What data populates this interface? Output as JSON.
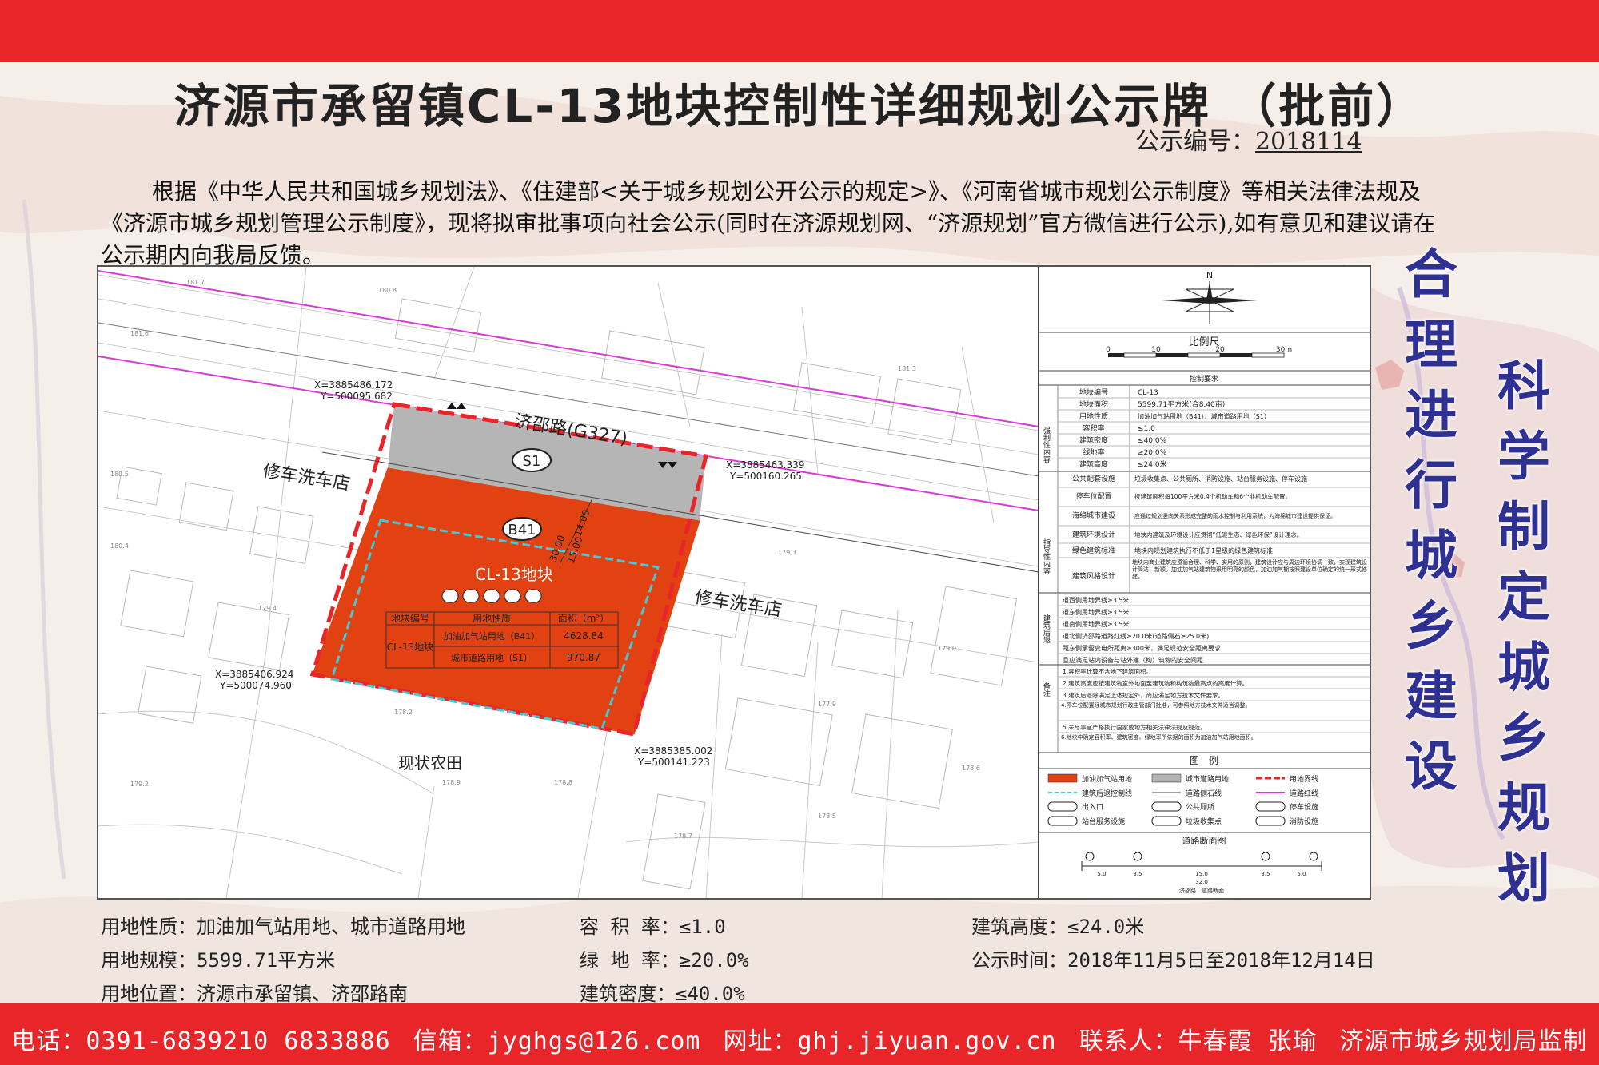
{
  "header": {
    "title": "济源市承留镇CL-13地块控制性详细规划公示牌 （批前）",
    "notice_label": "公示编号：",
    "notice_number": "2018114"
  },
  "intro": "根据《中华人民共和国城乡规划法》、《住建部<关于城乡规划公开公示的规定>》、《河南省城市规划公示制度》等相关法律法规及《济源市城乡规划管理公示制度》，现将拟审批事项向社会公示(同时在济源规划网、“济源规划”官方微信进行公示),如有意见和建议请在公示期内向我局反馈。",
  "map": {
    "road_name": "济邵路(G327)",
    "road_code": "S1",
    "block_code": "B41",
    "block_name": "CL-13地块",
    "shop_label": "修车洗车店",
    "farmland_label": "现状农田",
    "dim_14": "14.00",
    "dim_30": "30.00",
    "dim_15": "15.00",
    "coords": [
      "X=3885486.172",
      "Y=500095.682",
      "X=3885463.339",
      "Y=500160.265",
      "X=3885406.924",
      "Y=500074.960",
      "X=3885385.002",
      "Y=500141.223"
    ],
    "elevations": [
      "181.7",
      "181.6",
      "180.5",
      "180.4",
      "179.4",
      "179.2",
      "178.9",
      "178.8",
      "178.7",
      "178.5",
      "178.2",
      "177.9",
      "179.3",
      "179.0",
      "178.6",
      "180.8",
      "181.3"
    ],
    "mini_table": {
      "headers": [
        "地块编号",
        "用地性质",
        "面积（m²）"
      ],
      "block_id": "CL-13地块",
      "rows": [
        {
          "use": "加油加气站用地（B41）",
          "area": "4628.84"
        },
        {
          "use": "城市道路用地（S1）",
          "area": "970.87"
        }
      ]
    }
  },
  "side_panel": {
    "north": "N",
    "scale_title": "比例尺",
    "scale_ticks": [
      "0",
      "10",
      "20",
      "30m"
    ],
    "control_title": "控制要求",
    "control_rows": [
      {
        "k": "地块编号",
        "v": "CL-13"
      },
      {
        "k": "地块面积",
        "v": "5599.71平方米(合8.40亩)"
      },
      {
        "k": "用地性质",
        "v": "加油加气站用地（B41）、城市道路用地（S1）"
      },
      {
        "k": "容积率",
        "v": "≤1.0"
      },
      {
        "k": "建筑密度",
        "v": "≤40.0%"
      },
      {
        "k": "绿地率",
        "v": "≥20.0%"
      },
      {
        "k": "建筑高度",
        "v": "≤24.0米"
      }
    ],
    "group_mandatory": "强制性内容",
    "guide_rows": [
      {
        "k": "公共配套设施",
        "v": "垃圾收集点、公共厕所、消防设施、站台服务设施、停车设施"
      },
      {
        "k": "停车位配置",
        "v": "按建筑面积每100平方米0.4个机动车和6个非机动车配置。"
      },
      {
        "k": "海绵城市建设",
        "v": "应通过规划竖向关系形成完整的雨水控制与利用系统，为海绵城市建设提供保证。"
      },
      {
        "k": "建筑环境设计",
        "v": "地块内建筑及环境设计应贯彻“低碳生态、绿色环保”设计理念。"
      },
      {
        "k": "绿色建筑标准",
        "v": "地块内规划建筑执行不低于1星级的绿色建筑标准"
      },
      {
        "k": "建筑风格设计",
        "v": "地块内商业建筑应遵循合理、科学、实用的原则，建筑设计应与周边环境协调一致，实现建筑设计简洁、新颖。加油加气站建筑物采用明亮的颜色，加油加气棚按照建设单位确定的统一形式修建。"
      }
    ],
    "group_guide": "指导性内容",
    "setback_rows": [
      "退西侧用地界线≥3.5米",
      "退东侧用地界线≥3.5米",
      "退南侧用地界线≥3.5米",
      "退北侧济邵路道路红线≥20.0米(道路侧石≥25.0米)",
      "距东侧承留变电所距离≥300米，满足规范安全距离要求",
      "且应满足站内设备与站外建（构）筑物的安全间距"
    ],
    "group_setback": "建筑后退",
    "notes_rows": [
      "1.容积率计算不含地下建筑面积。",
      "2.建筑高度应按建筑物室外地面至建筑物和构筑物最高点的高度计算。",
      "3.建筑后退除满足上述规定外，尚应满足地方技术文件要求。",
      "4.停车位配置经城市规划行政主管部门批准，可参照地方技术文件适当调整。",
      "5.未尽事宜严格执行国家或地方相关法律法规及规范。",
      "6.地块中确定容积率、建筑密度、绿地率所依据的面积为加油加气站用地面积。"
    ],
    "group_notes": "备注",
    "legend_title": "图　例",
    "legend_items": [
      "加油加气站用地",
      "城市道路用地",
      "用地界线",
      "建筑后退控制线",
      "道路侧石线",
      "道路红线",
      "出入口",
      "公共厕所",
      "停车设施",
      "站台服务设施",
      "垃圾收集点",
      "消防设施"
    ],
    "road_section_title": "道路断面图",
    "road_section_dims": [
      "5.0",
      "3.5",
      "15.0",
      "3.5",
      "5.0"
    ],
    "road_section_total": "32.0",
    "road_section_caption": "济邵路　道路断面"
  },
  "slogans": {
    "left": [
      "合",
      "理",
      "进",
      "行",
      "城",
      "乡",
      "建",
      "设"
    ],
    "right": [
      "科",
      "学",
      "制",
      "定",
      "城",
      "乡",
      "规",
      "划"
    ]
  },
  "info": {
    "land_use": "用地性质：加油加气站用地、城市道路用地",
    "land_area": "用地规模：5599.71平方米",
    "location": "用地位置：济源市承留镇、济邵路南",
    "far": "容 积 率：≤1.0",
    "green": "绿 地 率：≥20.0%",
    "density": "建筑密度：≤40.0%",
    "height": "建筑高度：≤24.0米",
    "period": "公示时间：2018年11月5日至2018年12月14日"
  },
  "footer": {
    "phone": "电话：0391-6839210 6833886",
    "email": "信箱：jyghgs@126.com",
    "web": "网址：ghj.jiyuan.gov.cn",
    "contact": "联系人：牛春霞 张瑜",
    "supervisor": "济源市城乡规划局监制"
  },
  "colors": {
    "bar_red": "#e8262a",
    "block_red": "#e24212",
    "road_gray": "#b5b5b5",
    "slogan_blue": "#2e3192",
    "magenta_line": "#d83ad8",
    "setback_cyan": "#47c8d8"
  }
}
